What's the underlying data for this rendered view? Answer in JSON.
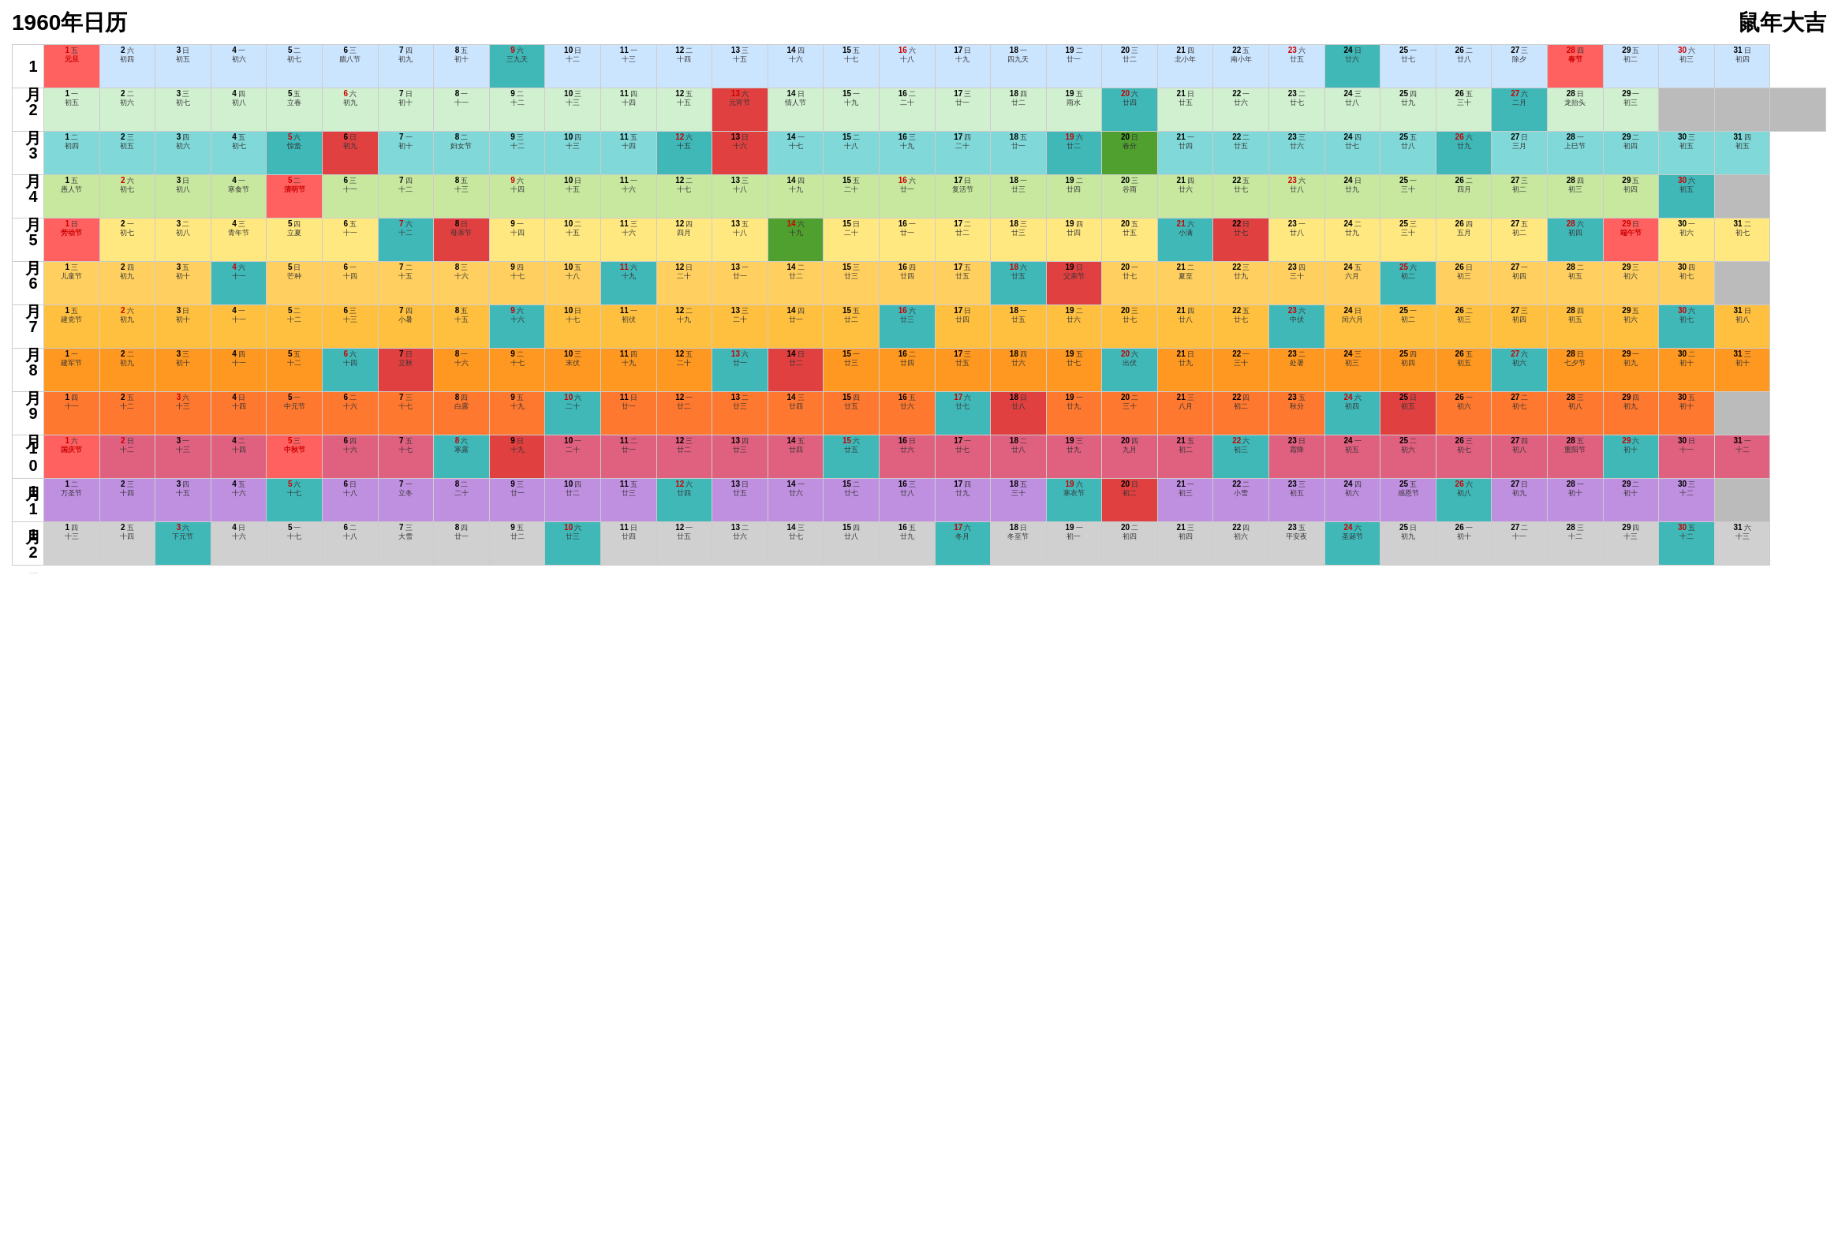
{
  "header": {
    "title": "1960年日历",
    "zodiac": "鼠年大吉"
  },
  "months": [
    {
      "name": "1月",
      "days": 31
    },
    {
      "name": "2月",
      "days": 29
    },
    {
      "name": "3月",
      "days": 31
    },
    {
      "name": "4月",
      "days": 30
    },
    {
      "name": "5月",
      "days": 31
    },
    {
      "name": "6月",
      "days": 30
    },
    {
      "name": "7月",
      "days": 31
    },
    {
      "name": "8月",
      "days": 31
    },
    {
      "name": "9月",
      "days": 30
    },
    {
      "name": "10月",
      "days": 31
    },
    {
      "name": "11月",
      "days": 30
    },
    {
      "name": "12月",
      "days": 31
    }
  ]
}
